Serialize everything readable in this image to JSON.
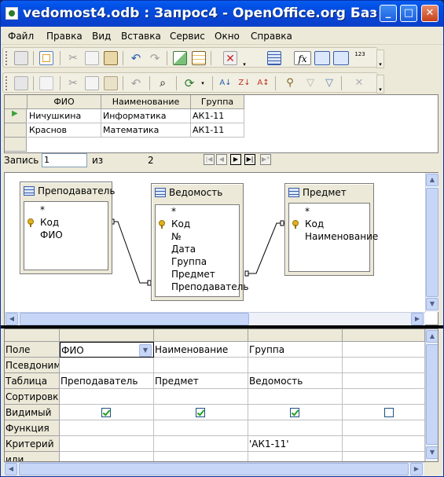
{
  "window": {
    "title": "vedomost4.odb : Запрос4 - OpenOffice.org Баз",
    "minimize_glyph": "_",
    "maximize_glyph": "□",
    "close_glyph": "✕"
  },
  "menu": [
    "Файл",
    "Правка",
    "Вид",
    "Вставка",
    "Сервис",
    "Окно",
    "Справка"
  ],
  "results": {
    "columns": [
      "ФИО",
      "Наименование",
      "Группа"
    ],
    "rows": [
      [
        "Ничушкина",
        "Информатика",
        "АК1-11"
      ],
      [
        "Краснов",
        "Математика",
        "АК1-11"
      ]
    ],
    "current_row_marker": "▶"
  },
  "record_nav": {
    "label": "Запись",
    "current": "1",
    "of_label": "из",
    "total": "2"
  },
  "tables": [
    {
      "name": "Преподаватель",
      "fields": [
        "*",
        "Код",
        "ФИО"
      ],
      "keys": [
        1
      ]
    },
    {
      "name": "Ведомость",
      "fields": [
        "*",
        "Код",
        "№",
        "Дата",
        "Группа",
        "Предмет",
        "Преподаватель"
      ],
      "keys": [
        1
      ]
    },
    {
      "name": "Предмет",
      "fields": [
        "*",
        "Код",
        "Наименование"
      ],
      "keys": [
        1
      ]
    }
  ],
  "criteria": {
    "row_labels": [
      "Поле",
      "Псевдоним",
      "Таблица",
      "Сортировка",
      "Видимый",
      "Функция",
      "Критерий",
      "или"
    ],
    "columns": [
      {
        "field": "ФИО",
        "alias": "",
        "table": "Преподаватель",
        "sort": "",
        "visible": true,
        "function": "",
        "criterion": "",
        "or": ""
      },
      {
        "field": "Наименование",
        "alias": "",
        "table": "Предмет",
        "sort": "",
        "visible": true,
        "function": "",
        "criterion": "",
        "or": ""
      },
      {
        "field": "Группа",
        "alias": "",
        "table": "Ведомость",
        "sort": "",
        "visible": true,
        "function": "",
        "criterion": "'АК1-11'",
        "or": ""
      },
      {
        "field": "",
        "alias": "",
        "table": "",
        "sort": "",
        "visible": false,
        "function": "",
        "criterion": "",
        "or": ""
      }
    ]
  },
  "toolbar1_icons": [
    "save-icon",
    "edit-icon",
    "cut-icon",
    "copy-icon",
    "paste-icon",
    "undo-icon",
    "redo-icon",
    "run-query-icon",
    "design-view-icon",
    "clear-query-icon",
    "add-table-icon",
    "functions-icon",
    "table-name-icon",
    "alias-icon",
    "distinct-values-icon"
  ],
  "toolbar2_icons": [
    "save-record-icon",
    "edit-data-icon",
    "cut-icon",
    "copy-icon",
    "paste-icon",
    "undo-icon",
    "find-icon",
    "refresh-icon",
    "sort-ascending-icon",
    "sort-descending-icon",
    "sort-icon",
    "autofilter-icon",
    "apply-filter-icon",
    "standard-filter-icon",
    "remove-filter-icon"
  ],
  "toolbar_distinct_label": "123",
  "colors": {
    "title_gradient": "#0a5cf0",
    "window_bg": "#ece9d8",
    "checkmark": "#21a121"
  }
}
